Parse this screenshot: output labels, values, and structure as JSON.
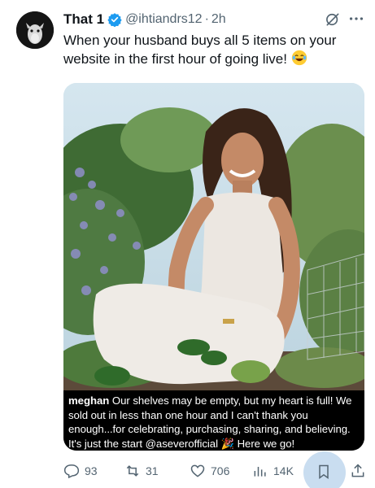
{
  "tweet": {
    "display_name": "That 1",
    "handle": "@ihtiandrs12",
    "separator": "·",
    "time": "2h",
    "text": "When your husband buys all 5 items on your website in the first hour of going live!",
    "emoji": "face-with-tears-of-joy",
    "verified_color": "#1d9bf0"
  },
  "media": {
    "caption_username": "meghan",
    "caption_text": " Our shelves may be empty, but my heart is full! We sold out in less than one hour and I can't thank you enough...for celebrating, purchasing, sharing, and believing. It's just the start @aseverofficial ",
    "caption_emoji": "party-popper",
    "caption_end": " Here we go!"
  },
  "actions": {
    "replies": "93",
    "reposts": "31",
    "likes": "706",
    "views": "14K"
  },
  "icons": [
    "reply-icon",
    "repost-icon",
    "like-icon",
    "views-icon",
    "bookmark-icon",
    "share-icon",
    "grok-icon",
    "more-icon",
    "verified-icon"
  ]
}
